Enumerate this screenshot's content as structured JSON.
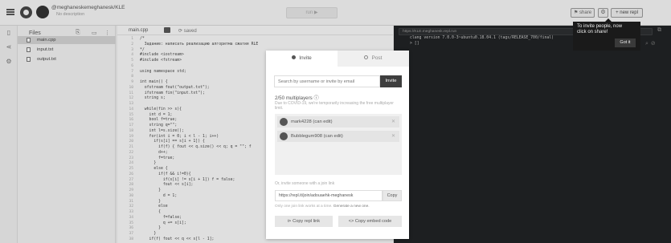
{
  "topbar": {
    "project_title": "@meghaneskemeghanesk/KLE",
    "project_desc": "No description",
    "run_label": "run ▶",
    "share_label": "share",
    "new_repl_label": "+ new repl"
  },
  "files": {
    "header": "Files",
    "items": [
      {
        "name": "main.cpp",
        "active": true
      },
      {
        "name": "input.txt",
        "active": false
      },
      {
        "name": "output.txt",
        "active": false
      }
    ]
  },
  "editor": {
    "tab_file": "main.cpp",
    "saved_label": "saved",
    "lines": [
      "/*",
      "  Задание: написать реализацию алгоритма сжатия RLE",
      "*/",
      "#include <iostream>",
      "#include <fstream>",
      "",
      "using namespace std;",
      "",
      "int main() {",
      "  ofstream fout(\"output.txt\");",
      "  ifstream fin(\"input.txt\");",
      "  string s;",
      "",
      "  while(fin >> s){",
      "    int d = 1;",
      "    bool f=true;",
      "    string q=\"\";",
      "    int l=s.size();",
      "    for(int i = 0; i < l - 1; i++)",
      "      if(s[i] == s[i + 1]) {",
      "        if(f) { fout << q.size() << q; q = \"\"; f",
      "        d++;",
      "        f=true;",
      "      }",
      "      else {",
      "        if(f && i!=0){",
      "          if(s[i] != s[i + 1]) f = false;",
      "          fout << s[i];",
      "        }",
      "          d = 1;",
      "        }",
      "        else",
      "        {",
      "          f=false;",
      "          q += s[i];",
      "        }",
      "      }",
      "    if(f) fout << q << s[l - 1];"
    ],
    "line_numbers": [
      "1",
      "2",
      "3",
      "4",
      "5",
      "6",
      "7",
      "8",
      "9",
      "10",
      "11",
      "12",
      "13",
      "14",
      "15",
      "16",
      "17",
      "18",
      "19",
      "20",
      "21",
      "22",
      "23",
      "24",
      "25",
      "26",
      "27",
      "28",
      "29",
      "30",
      "31",
      "32",
      "33",
      "34",
      "35",
      "36",
      "37",
      "38"
    ]
  },
  "console": {
    "url": "https://KLE.meghanesk.repl.run",
    "lines": [
      "clang version 7.0.0-3~ubuntu0.18.04.1 (tags/RELEASE_700/final)",
      "> []"
    ]
  },
  "tooltip": {
    "text": "To invite people, now click on share!",
    "button": "Got it"
  },
  "modal": {
    "tab_invite": "Invite",
    "tab_post": "Post",
    "search_placeholder": "Search by username or invite by email",
    "invite_button": "Invite",
    "multiplayer_count": "2/50 multiplayers ⓘ",
    "multiplayer_note": "Due to COVID-19, we're temporarily increasing the free multiplayer limit.",
    "members": [
      {
        "name": "mark4228 (can edit)"
      },
      {
        "name": "Bubblegum908 (can edit)"
      }
    ],
    "join_label": "Or, invite someone with a join link",
    "join_link": "https://repl.it/join/adouaehk-meghanesk",
    "copy_button": "Copy",
    "join_note_prefix": "Only one join link works at a time.",
    "join_note_action": "Generate a new one.",
    "copy_link_button": "⊳ Copy repl link",
    "embed_button": "<> Copy embed code"
  }
}
